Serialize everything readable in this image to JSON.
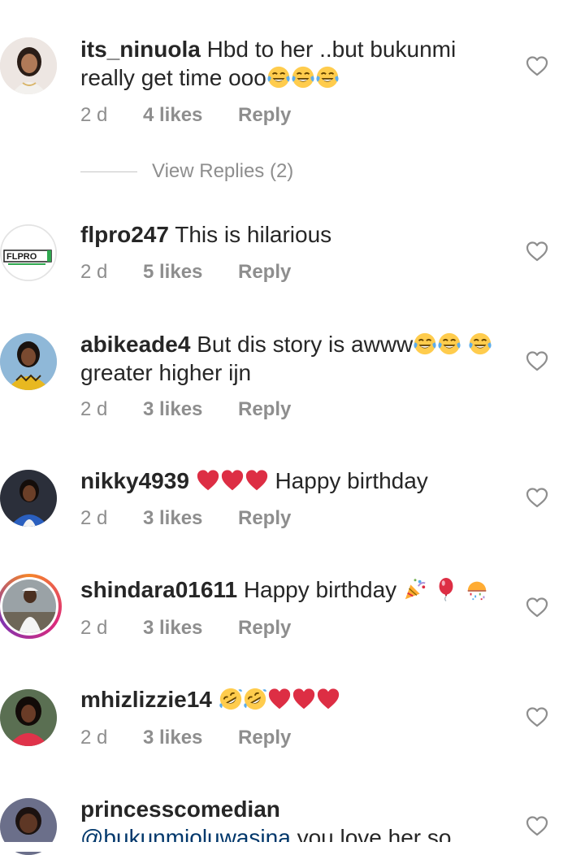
{
  "comments": [
    {
      "username": "its_ninuola",
      "text": "Hbd to her ..but bukunmi really get time ooo",
      "emojis": [
        "face-with-tears-of-joy",
        "face-with-tears-of-joy",
        "face-with-tears-of-joy"
      ],
      "time": "2 d",
      "likes": "4 likes",
      "reply": "Reply"
    },
    {
      "username": "flpro247",
      "text": "This is hilarious",
      "time": "2 d",
      "likes": "5 likes",
      "reply": "Reply",
      "avatar_text": "FLPRO"
    },
    {
      "username": "abikeade4",
      "text": "But dis story is awww",
      "text2": "greater higher ijn",
      "emojis": [
        "face-with-tears-of-joy",
        "face-with-tears-of-joy",
        "face-with-tears-of-joy"
      ],
      "time": "2 d",
      "likes": "3 likes",
      "reply": "Reply"
    },
    {
      "username": "nikky4939",
      "text": "Happy birthday",
      "emojis": [
        "red-heart",
        "red-heart",
        "red-heart"
      ],
      "time": "2 d",
      "likes": "3 likes",
      "reply": "Reply"
    },
    {
      "username": "shindara01611",
      "text": "Happy birthday",
      "emojis": [
        "party-popper",
        "balloon",
        "confetti-ball"
      ],
      "time": "2 d",
      "likes": "3 likes",
      "reply": "Reply"
    },
    {
      "username": "mhizlizzie14",
      "emojis": [
        "rolling-on-floor-laughing",
        "rolling-on-floor-laughing",
        "red-heart",
        "red-heart",
        "red-heart"
      ],
      "time": "2 d",
      "likes": "3 likes",
      "reply": "Reply"
    },
    {
      "username": "princesscomedian",
      "mention": "@bukunmioluwasina",
      "text": "you love her so"
    }
  ],
  "view_replies": "View Replies (2)",
  "colors": {
    "text": "#262626",
    "secondary": "#8e8e8e",
    "mention": "#00376b",
    "heart_outline": "#8e8e8e"
  }
}
